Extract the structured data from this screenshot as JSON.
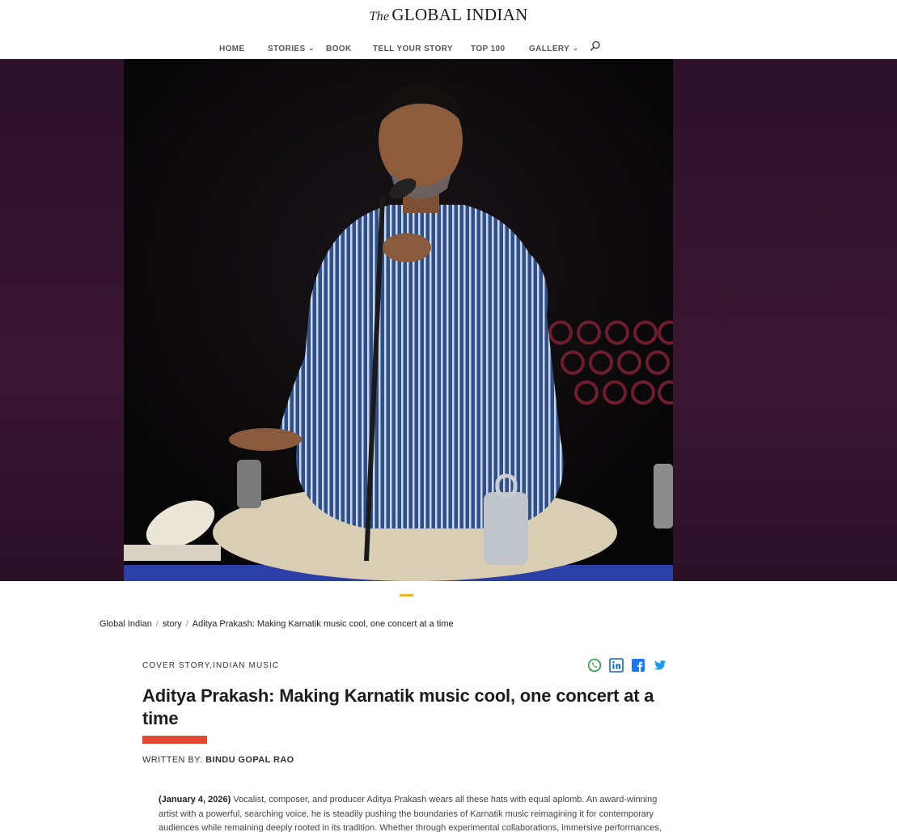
{
  "header": {
    "logo_the": "The",
    "logo_name": "GLOBAL INDIAN",
    "nav": [
      {
        "label": "HOME"
      },
      {
        "label": "STORIES"
      },
      {
        "label": "BOOK"
      },
      {
        "label": "TELL YOUR STORY"
      },
      {
        "label": "TOP 100"
      },
      {
        "label": "GALLERY"
      }
    ]
  },
  "breadcrumb": {
    "home": "Global Indian",
    "section": "story",
    "current": "Aditya Prakash: Making Karnatik music cool, one concert at a time",
    "separator": "/"
  },
  "article": {
    "category_1": "COVER STORY",
    "category_2": "INDIAN MUSIC",
    "category_sep": ",",
    "title": "Aditya Prakash: Making Karnatik music cool, one concert at a time",
    "byline_label": "WRITTEN BY: ",
    "author": "BINDU GOPAL RAO",
    "date": "(January 4, 2026)",
    "intro": " Vocalist, composer, and producer Aditya Prakash wears all these hats with equal aplomb. An award-winning artist with a powerful, searching voice, he is steadily pushing the boundaries of Karnatik music reimagining it for contemporary audiences while remaining deeply rooted in its tradition. Whether through experimental collaborations, immersive performances,"
  },
  "colors": {
    "accent_bar": "#e04a32",
    "slider_active": "#e7b52b",
    "whatsapp": "#25a244",
    "linkedin": "#0a66c2",
    "facebook": "#1877f2",
    "twitter": "#1d9bf0"
  }
}
